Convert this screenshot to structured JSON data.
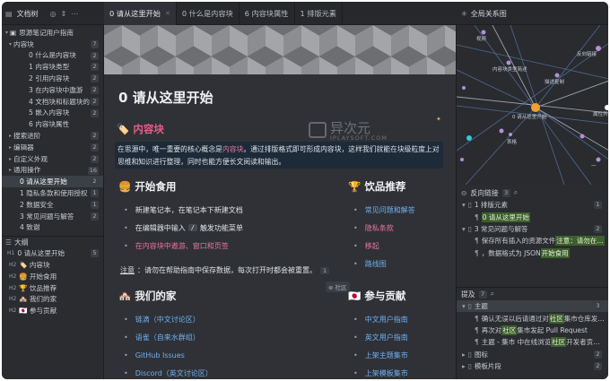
{
  "toolbar": {
    "doc_tree_label": "文档树",
    "tabs": [
      {
        "label": "0 请从这里开始",
        "active": true
      },
      {
        "label": "0 什么是内容块",
        "active": false
      },
      {
        "label": "6 内容块属性",
        "active": false
      },
      {
        "label": "1 排版元素",
        "active": false
      }
    ],
    "graph_title": "全局关系图"
  },
  "sidebar": {
    "notebook": "思源笔记用户指南",
    "group": {
      "label": "内容块",
      "count": "7"
    },
    "subitems": [
      {
        "label": "0 什么是内容块",
        "count": "2"
      },
      {
        "label": "1 内容块类型",
        "count": "2"
      },
      {
        "label": "2 引用内容块",
        "count": "2"
      },
      {
        "label": "3 在内容块中遨游",
        "count": "2"
      },
      {
        "label": "4 文档块和标题块的…",
        "count": "2"
      },
      {
        "label": "5 嵌入内容块",
        "count": "2"
      },
      {
        "label": "6 内容块属性",
        "count": ""
      }
    ],
    "groups2": [
      {
        "label": "搜索进阶",
        "count": "2"
      },
      {
        "label": "编辑器",
        "count": "2"
      },
      {
        "label": "自定义外观",
        "count": "2"
      },
      {
        "label": "通用操作",
        "count": "16"
      }
    ],
    "items2": [
      {
        "label": "0 请从这里开始",
        "count": "2",
        "selected": true
      },
      {
        "label": "1 隐私条款和使用授权",
        "count": "1"
      },
      {
        "label": "2 数据安全",
        "count": "1"
      },
      {
        "label": "3 常见问题与解答",
        "count": "2"
      },
      {
        "label": "4 致谢",
        "count": ""
      }
    ],
    "outline_title": "大纲",
    "outline": [
      {
        "label": "0 请从这里开始",
        "count": "5",
        "level": "H1"
      },
      {
        "label": "内容块",
        "count": "",
        "level": "H2",
        "emoji": "🏷️"
      },
      {
        "label": "开始食用",
        "count": "",
        "level": "H2",
        "emoji": "🍔"
      },
      {
        "label": "饮品推荐",
        "count": "",
        "level": "H2",
        "emoji": "🏆"
      },
      {
        "label": "我们的家",
        "count": "",
        "level": "H2",
        "emoji": "🏘️"
      },
      {
        "label": "参与贡献",
        "count": "",
        "level": "H2",
        "emoji": "🇯🇵"
      }
    ]
  },
  "editor": {
    "title": "0 请从这里开始",
    "watermark": "异次元",
    "watermark_sub": "IPLAYSOFT.COM",
    "h_blocks": "内容块",
    "note_pre": "在思源中，唯一重要的核心概念是",
    "note_link": "内容块",
    "note_post": "。通过排版格式即可形成内容块，这样我们就能在块级粒度上对思维和知识进行整理，同时也能方便长文阅读和输出。",
    "h_start": "开始食用",
    "start_items": [
      {
        "text": "新建笔记本，在笔记本下新建文档"
      },
      {
        "pre": "在编辑器中输入",
        "key": "/",
        "post": "触发功能菜单"
      },
      {
        "text": "在内容块中遨游、窗口和页签"
      }
    ],
    "tip_label": "注意",
    "tip_text": "：请勿在帮助指南中保存数据，每次打开时都会被重置。",
    "tip_count": "1",
    "h_drinks": "饮品推荐",
    "drink_items": [
      "常见问题和解答",
      "隐私条款",
      "移起",
      "路线图"
    ],
    "h_home": "我们的家",
    "home_tag": "社区",
    "home_items": [
      "链滴（中文讨论区）",
      "语雀（自来水群组）",
      "GitHub Issues",
      "Discord（英文讨论区）"
    ],
    "h_contrib": "参与贡献",
    "contrib_items": [
      "中文用户指南",
      "英文用户指南",
      "上架主题集市",
      "上架模板集市"
    ]
  },
  "graph": {
    "labels": [
      {
        "text": "视频"
      },
      {
        "text": "反向链接"
      },
      {
        "text": "内容块类型简述"
      },
      {
        "text": "描述复制"
      },
      {
        "text": "0 请从这里开始"
      },
      {
        "text": "属性列"
      },
      {
        "text": "表格"
      },
      {
        "text": "一"
      }
    ]
  },
  "backlinks": {
    "title": "反向链接",
    "count": "3",
    "rows": [
      {
        "label": "1 排版元素",
        "count": "1"
      },
      {
        "label": "0 请从这里开始",
        "count": ""
      },
      {
        "label": "3 常见问题与解答",
        "count": "2"
      },
      {
        "pre": "保存所有插入的资源文件",
        "hl": "注意：请勿在…",
        "post": "",
        "count": ""
      },
      {
        "pre": "，数据格式为 JSON",
        "hl": "开始食用",
        "post": "",
        "count": ""
      }
    ]
  },
  "mentions": {
    "title": "提及",
    "count": "7",
    "rows": [
      {
        "label": "主题",
        "count": "3",
        "selected": true
      },
      {
        "pre": "确认无误以后请通过对",
        "hl": "社区",
        "post": "集市仓库发…",
        "count": ""
      },
      {
        "pre": "再次对",
        "hl": "社区",
        "post": "集市发起 Pull Request",
        "count": ""
      },
      {
        "pre": "主题 - 集市 中在线浏览",
        "hl": "社区",
        "post": "开发者贡…",
        "count": ""
      },
      {
        "label": "图标",
        "count": "2"
      },
      {
        "label": "模板片段",
        "count": "2"
      }
    ]
  }
}
